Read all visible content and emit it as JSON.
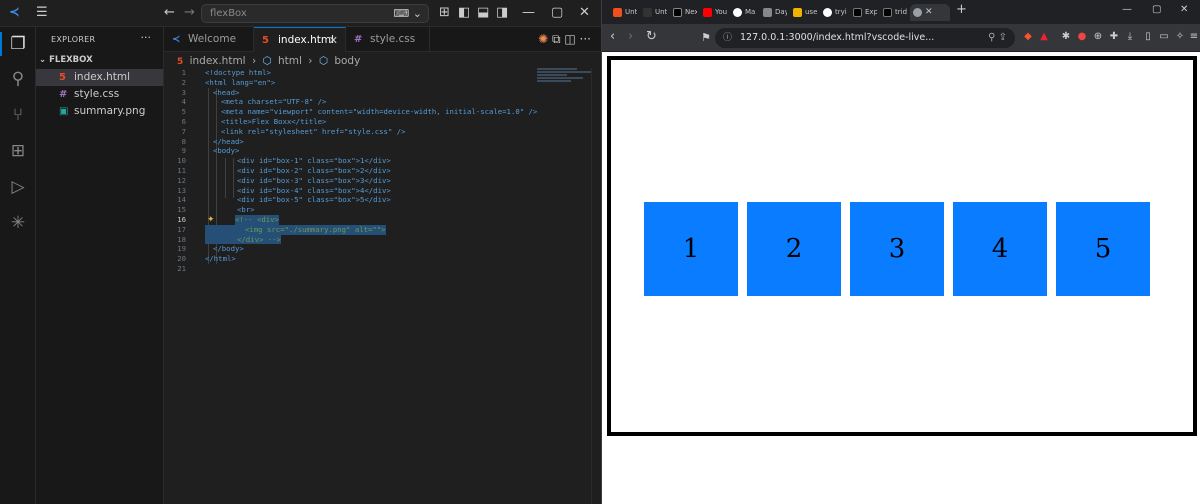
{
  "vscode": {
    "search_box": "flexBox",
    "sidebar": {
      "title": "EXPLORER",
      "more": "···",
      "folder": "FLEXBOX",
      "files": [
        {
          "name": "index.html",
          "icon": "html-file-icon",
          "glyph": "5",
          "color": "#e44d26"
        },
        {
          "name": "style.css",
          "icon": "css-file-icon",
          "glyph": "#",
          "color": "#a074c4"
        },
        {
          "name": "summary.png",
          "icon": "image-file-icon",
          "glyph": "▣",
          "color": "#26a69a"
        }
      ]
    },
    "tabs": [
      {
        "label": "Welcome",
        "icon": "vscode-icon",
        "glyph": "≺",
        "color": "#3b8eea"
      },
      {
        "label": "index.html",
        "icon": "html-file-icon",
        "glyph": "5",
        "color": "#e44d26",
        "close": "✕"
      },
      {
        "label": "style.css",
        "icon": "css-file-icon",
        "glyph": "#",
        "color": "#a074c4"
      }
    ],
    "breadcrumb": [
      "index.html",
      "html",
      "body"
    ],
    "code_lines": [
      "1",
      "2",
      "3",
      "4",
      "5",
      "6",
      "7",
      "8",
      "9",
      "10",
      "11",
      "12",
      "13",
      "14",
      "15",
      "16",
      "17",
      "18",
      "19",
      "20",
      "21"
    ],
    "code": {
      "l1": "<!doctype html>",
      "l2": "<html lang=\"en\">",
      "l3": "<head>",
      "l4": "<meta charset=\"UTF-8\" />",
      "l5": "<meta name=\"viewport\" content=\"width=device-width, initial-scale=1.0\" />",
      "l6": "<title>Flex Boxx</title>",
      "l7": "<link rel=\"stylesheet\" href=\"style.css\" />",
      "l8": "</head>",
      "l9": "<body>",
      "l10": "<div id=\"box-1\" class=\"box\">1</div>",
      "l11": "<div id=\"box-2\" class=\"box\">2</div>",
      "l12": "<div id=\"box-3\" class=\"box\">3</div>",
      "l13": "<div id=\"box-4\" class=\"box\">4</div>",
      "l14": "<div id=\"box-5\" class=\"box\">5</div>",
      "l15": "<br>",
      "l16": "<!-- <div>",
      "l17": "<img src=\"./summary.png\" alt=\"\">",
      "l18": "</div> -->",
      "l19": "</body>",
      "l20": "</html>"
    }
  },
  "browser": {
    "tabs": [
      {
        "label": "Unt",
        "color": "#f24e1e"
      },
      {
        "label": "Unt",
        "color": "#333333"
      },
      {
        "label": "Nex",
        "color": "#000000"
      },
      {
        "label": "You",
        "color": "#ff0000"
      },
      {
        "label": "Ma",
        "color": "#ffffff"
      },
      {
        "label": "Day",
        "color": "#888888"
      },
      {
        "label": "use",
        "color": "#f0b400"
      },
      {
        "label": "tryi",
        "color": "#ffffff"
      },
      {
        "label": "Exp",
        "color": "#000000"
      },
      {
        "label": "trid",
        "color": "#000000"
      }
    ],
    "active_tab_close": "✕",
    "new_tab": "+",
    "url": "127.0.0.1:3000/index.html?vscode-live...",
    "boxes": [
      "1",
      "2",
      "3",
      "4",
      "5"
    ],
    "box_color": "#0a7cff"
  }
}
